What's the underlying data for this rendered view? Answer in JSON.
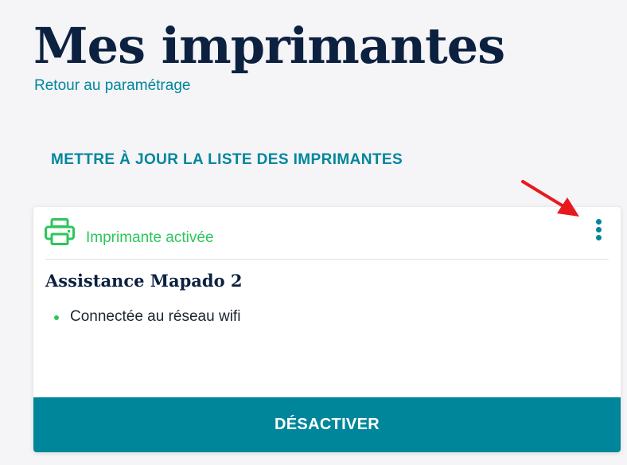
{
  "header": {
    "title": "Mes imprimantes",
    "back_link": "Retour au paramétrage"
  },
  "actions": {
    "update_list": "METTRE À JOUR LA LISTE DES IMPRIMANTES"
  },
  "printer_card": {
    "icon": "printer-icon",
    "status": "Imprimante activée",
    "name": "Assistance Mapado 2",
    "features": [
      "Connectée au réseau wifi"
    ],
    "menu_icon": "kebab-menu-icon",
    "deactivate_label": "DÉSACTIVER"
  },
  "colors": {
    "background": "#f5f4f7",
    "title": "#0c2140",
    "accent": "#00869b",
    "status_green": "#2cc65b",
    "annotation_arrow": "#e8191c"
  }
}
